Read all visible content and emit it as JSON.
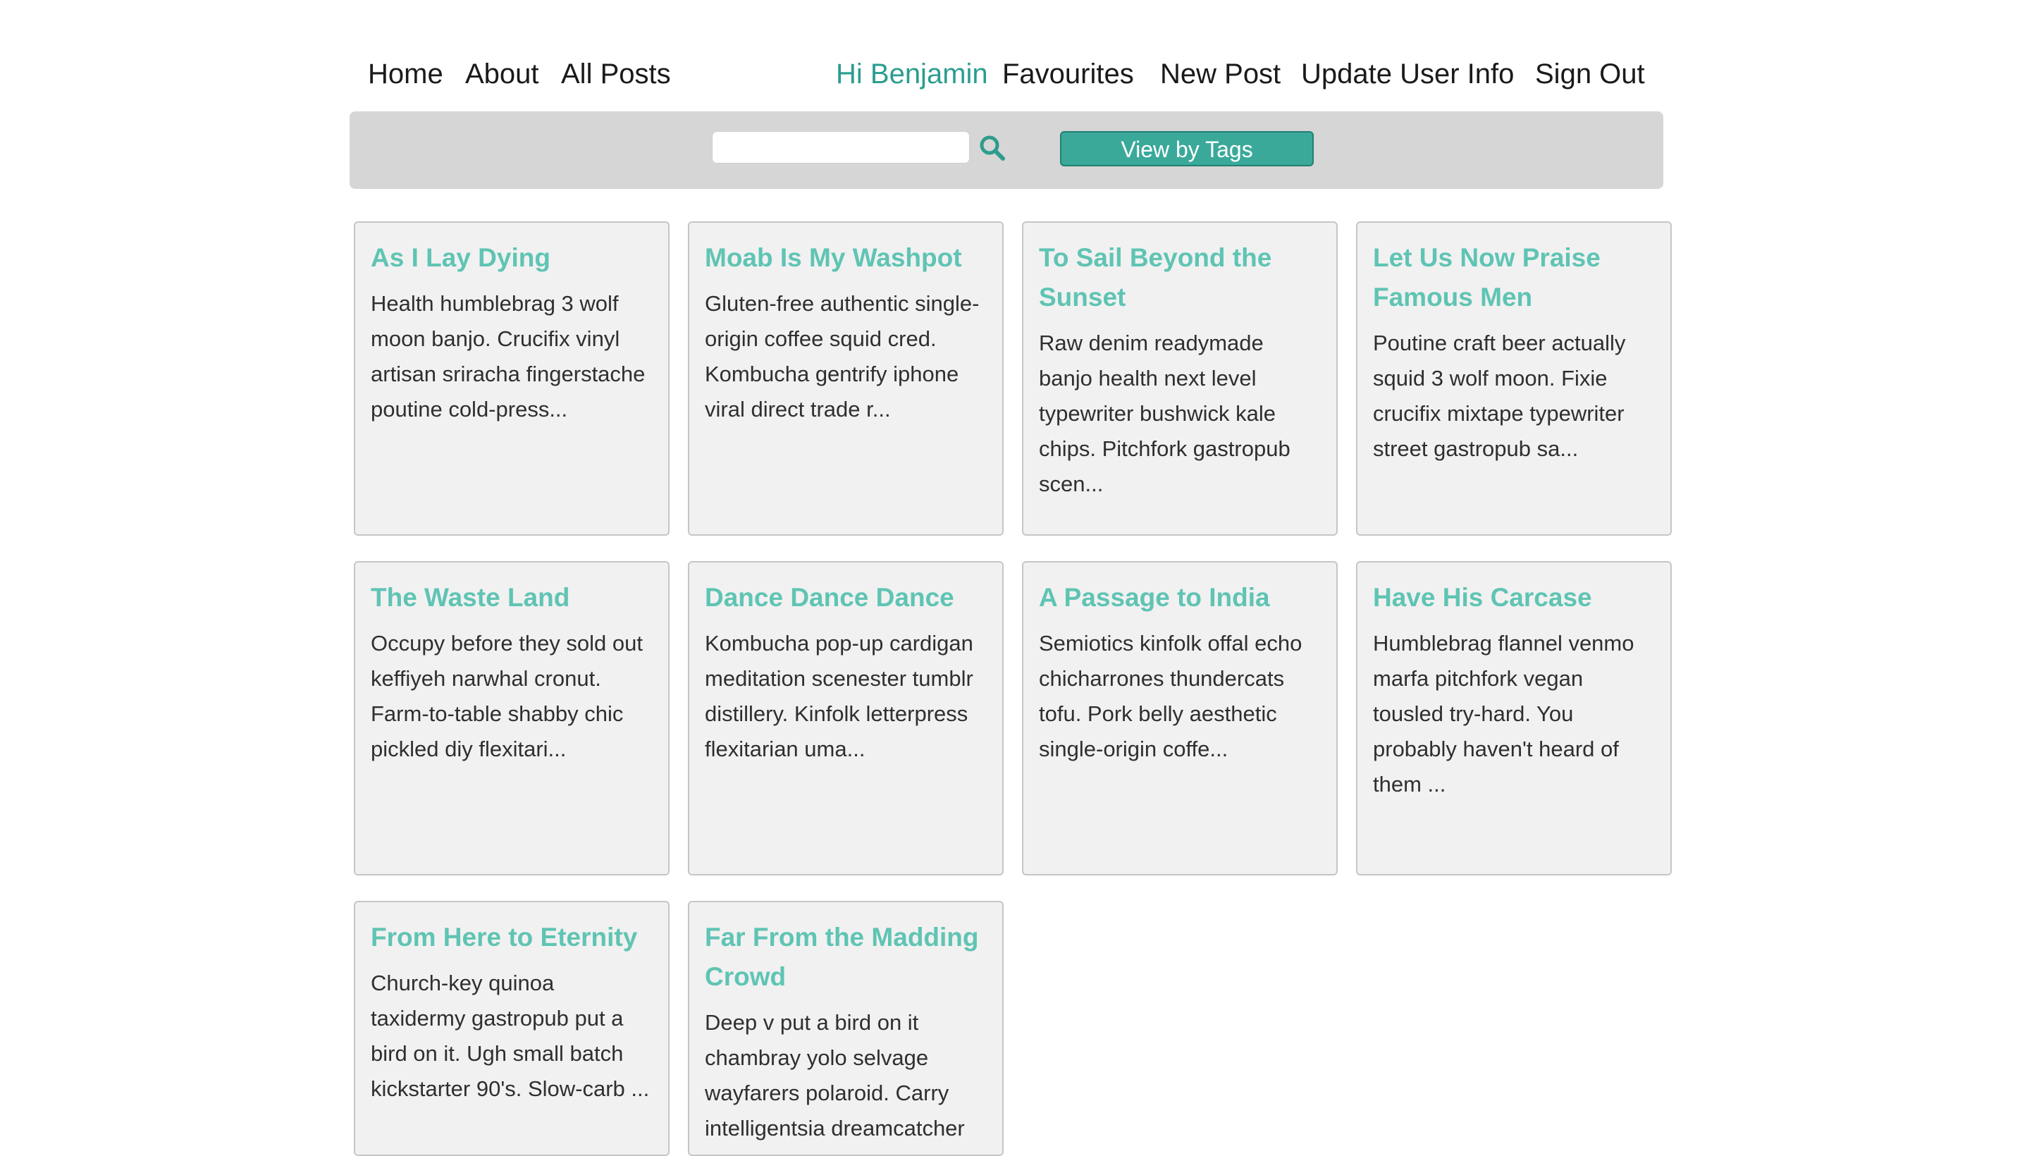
{
  "nav": {
    "left": [
      "Home",
      "About",
      "All Posts"
    ],
    "greeting": "Hi Benjamin",
    "right": [
      "Favourites",
      "New Post",
      "Update User Info",
      "Sign Out"
    ]
  },
  "search": {
    "value": "",
    "placeholder": "",
    "icon": "search-icon",
    "tags_button": "View by Tags"
  },
  "colors": {
    "accent": "#3aa99a",
    "title": "#5fc4b3",
    "greeting": "#2a9d8f",
    "bar": "#d6d6d6",
    "card": "#f1f1f1"
  },
  "posts": [
    {
      "title": "As I Lay Dying",
      "excerpt": "Health humblebrag 3 wolf moon banjo. Crucifix vinyl artisan sriracha fingerstache poutine cold-press..."
    },
    {
      "title": "Moab Is My Washpot",
      "excerpt": "Gluten-free authentic single-origin coffee squid cred. Kombucha gentrify iphone viral direct trade r..."
    },
    {
      "title": "To Sail Beyond the Sunset",
      "excerpt": "Raw denim readymade banjo health next level typewriter bushwick kale chips. Pitchfork gastropub scen..."
    },
    {
      "title": "Let Us Now Praise Famous Men",
      "excerpt": "Poutine craft beer actually squid 3 wolf moon. Fixie crucifix mixtape typewriter street gastropub sa..."
    },
    {
      "title": "The Waste Land",
      "excerpt": "Occupy before they sold out keffiyeh narwhal cronut. Farm-to-table shabby chic pickled diy flexitari..."
    },
    {
      "title": "Dance Dance Dance",
      "excerpt": "Kombucha pop-up cardigan meditation scenester tumblr distillery. Kinfolk letterpress flexitarian uma..."
    },
    {
      "title": "A Passage to India",
      "excerpt": "Semiotics kinfolk offal echo chicharrones thundercats tofu. Pork belly aesthetic single-origin coffe..."
    },
    {
      "title": "Have His Carcase",
      "excerpt": "Humblebrag flannel venmo marfa pitchfork vegan tousled try-hard. You probably haven't heard of them ..."
    },
    {
      "title": "From Here to Eternity",
      "excerpt": "Church-key quinoa taxidermy gastropub put a bird on it. Ugh small batch kickstarter 90's. Slow-carb ..."
    },
    {
      "title": "Far From the Madding Crowd",
      "excerpt": "Deep v put a bird on it chambray yolo selvage wayfarers polaroid. Carry intelligentsia dreamcatcher"
    }
  ]
}
